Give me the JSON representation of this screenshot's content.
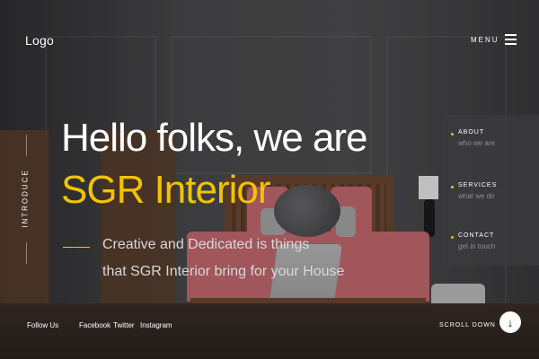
{
  "header": {
    "logo": "Logo",
    "menu_label": "MENU"
  },
  "side": {
    "intro_label": "INTRODUCE"
  },
  "hero": {
    "title_line1": "Hello folks, we are",
    "title_line2": "SGR Interior",
    "subtitle_line1": "Creative and Dedicated is things",
    "subtitle_line2": "that SGR Interior bring for your House"
  },
  "nav": {
    "items": [
      {
        "title": "ABOUT",
        "desc": "who we are"
      },
      {
        "title": "SERVICES",
        "desc": "what we do"
      },
      {
        "title": "CONTACT",
        "desc": "get in touch"
      }
    ]
  },
  "footer": {
    "follow_label": "Follow Us",
    "social": [
      "Facebook",
      "Twitter",
      "Instagram"
    ],
    "scroll_label": "SCROLL DOWN"
  },
  "icons": {
    "menu": "hamburger-icon",
    "scroll": "arrow-down-icon"
  },
  "colors": {
    "accent": "#f2c300",
    "text": "#ffffff",
    "muted": "#8f8f8f"
  }
}
